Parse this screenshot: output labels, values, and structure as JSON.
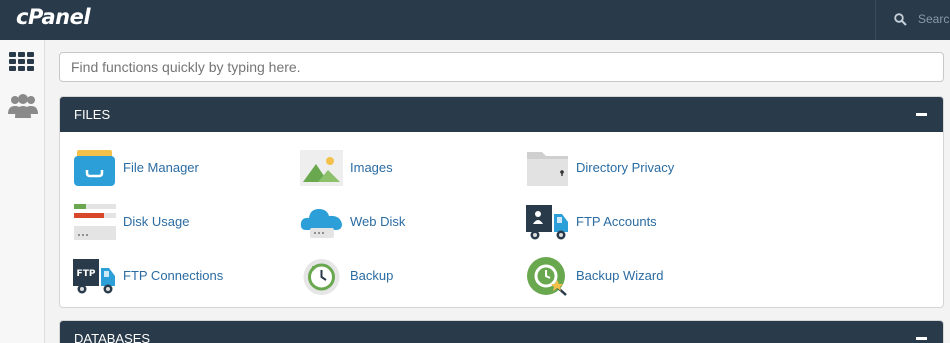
{
  "topbar": {
    "logo_text": "cPanel",
    "search_label": "Search"
  },
  "find": {
    "placeholder": "Find functions quickly by typing here."
  },
  "sections": {
    "files": {
      "title": "FILES",
      "items": [
        {
          "label": "File Manager",
          "icon": "file-manager-icon"
        },
        {
          "label": "Images",
          "icon": "images-icon"
        },
        {
          "label": "Directory Privacy",
          "icon": "directory-privacy-icon"
        },
        {
          "label": "Disk Usage",
          "icon": "disk-usage-icon"
        },
        {
          "label": "Web Disk",
          "icon": "web-disk-icon"
        },
        {
          "label": "FTP Accounts",
          "icon": "ftp-accounts-icon"
        },
        {
          "label": "FTP Connections",
          "icon": "ftp-connections-icon"
        },
        {
          "label": "Backup",
          "icon": "backup-icon"
        },
        {
          "label": "Backup Wizard",
          "icon": "backup-wizard-icon"
        }
      ]
    },
    "databases": {
      "title": "DATABASES"
    }
  },
  "colors": {
    "header": "#293a4a",
    "link": "#2b6ca3",
    "accent_blue": "#2d9fd8",
    "accent_green": "#6aa84f"
  }
}
